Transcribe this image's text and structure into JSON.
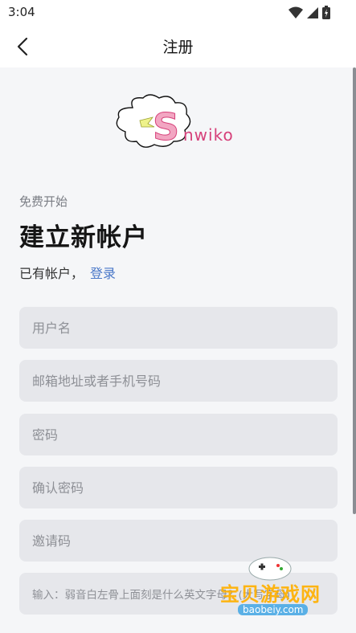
{
  "status_bar": {
    "time": "3:04",
    "icons": [
      "wifi-icon",
      "signal-icon",
      "battery-icon"
    ]
  },
  "app_bar": {
    "title": "注册",
    "back_icon": "chevron-left-icon"
  },
  "logo": {
    "text": "Snwiko",
    "accent_color": "#e8578a"
  },
  "heading": {
    "eyebrow": "免费开始",
    "title": "建立新帐户"
  },
  "account": {
    "prompt": "已有帐户，",
    "login_link": "登录",
    "link_color": "#4a78c8"
  },
  "form": {
    "username_placeholder": "用户名",
    "contact_placeholder": "邮箱地址或者手机号码",
    "password_placeholder": "密码",
    "confirm_placeholder": "确认密码",
    "invite_placeholder": "邀请码",
    "question_placeholder": "输入：弱音白左骨上面刻是什么英文字母？(大写字母)"
  },
  "watermark": {
    "text": "宝贝游戏网",
    "domain": "baobeiy.com"
  }
}
